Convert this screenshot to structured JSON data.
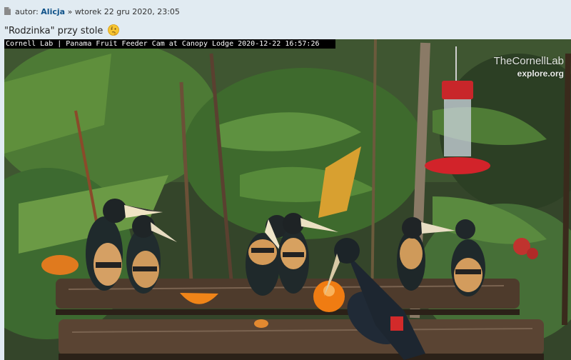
{
  "post": {
    "author_prefix": "autor:",
    "author": "Alicja",
    "separator": "»",
    "date": "wtorek 22 gru 2020, 23:05",
    "text": "\"Rodzinka\" przy stole"
  },
  "icons": [
    "document-icon",
    "thinking-emoji-icon"
  ],
  "camera": {
    "caption": "Cornell Lab | Panama Fruit Feeder Cam at Canopy Lodge 2020-12-22 16:57:26",
    "brand_name": "TheCornellLab",
    "brand_sub": "explore.org"
  },
  "colors": {
    "page_background": "#e1ebf2",
    "author_link": "#105289",
    "caption_bar": "#000000"
  }
}
